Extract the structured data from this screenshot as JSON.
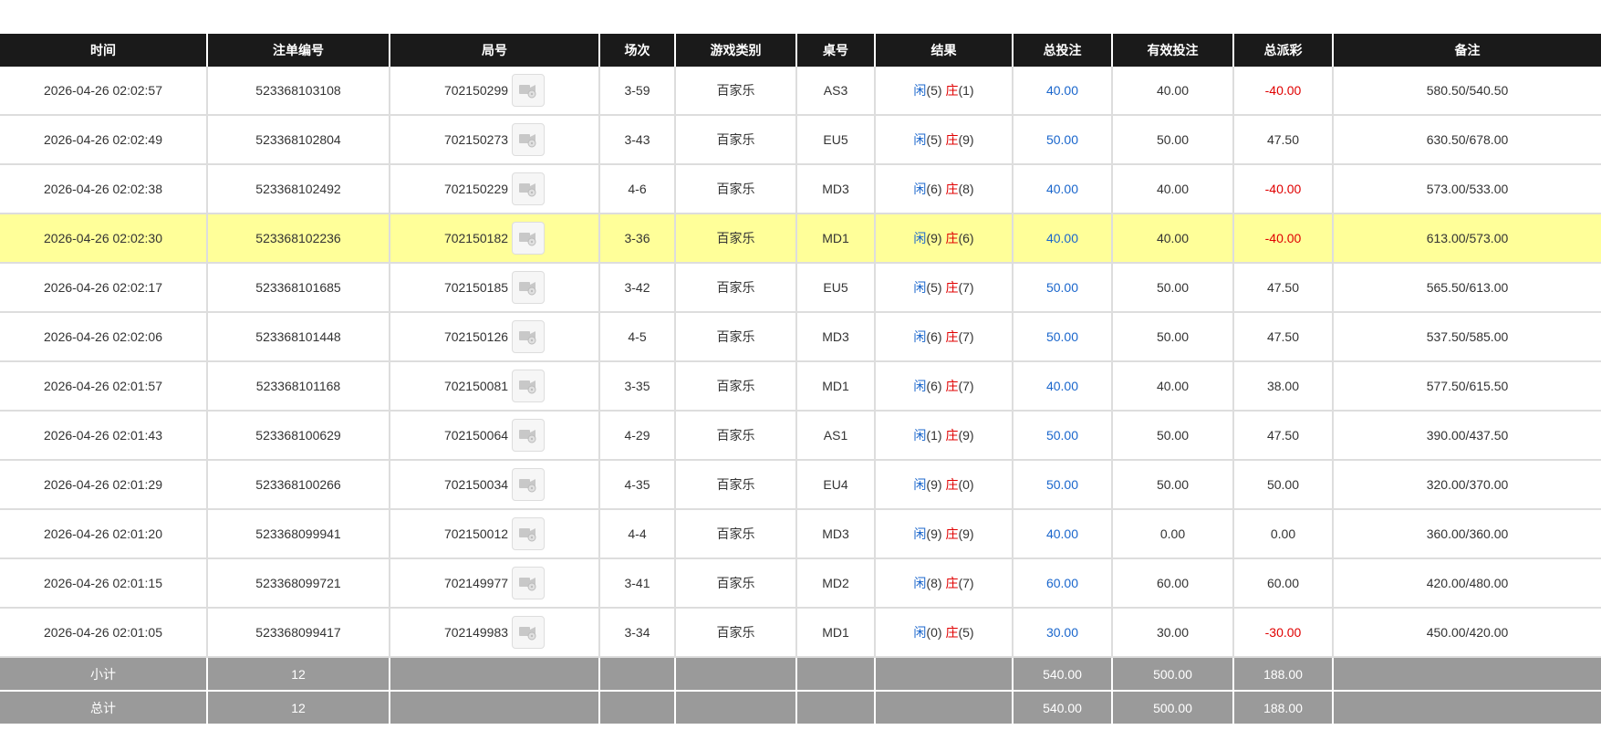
{
  "columns": [
    "时间",
    "注单编号",
    "局号",
    "场次",
    "游戏类别",
    "桌号",
    "结果",
    "总投注",
    "有效投注",
    "总派彩",
    "备注"
  ],
  "colors": {
    "header_bg": "#1a1a1a",
    "highlight_row": "#ffff99",
    "bet_blue": "#1a66cc",
    "loss_red": "#e00000",
    "summary_bg": "#9a9a9a"
  },
  "icons": {
    "replay": "video-replay-icon"
  },
  "rows": [
    {
      "time": "2026-04-26 02:02:57",
      "bet_id": "523368103108",
      "round": "702150299",
      "session": "3-59",
      "game": "百家乐",
      "table": "AS3",
      "xian_label": "闲",
      "xian_val": "(5)",
      "zhuang_label": "庄",
      "zhuang_val": "(1)",
      "total_bet": "40.00",
      "valid_bet": "40.00",
      "payout": "-40.00",
      "payout_neg": true,
      "remark": "580.50/540.50",
      "highlight": false
    },
    {
      "time": "2026-04-26 02:02:49",
      "bet_id": "523368102804",
      "round": "702150273",
      "session": "3-43",
      "game": "百家乐",
      "table": "EU5",
      "xian_label": "闲",
      "xian_val": "(5)",
      "zhuang_label": "庄",
      "zhuang_val": "(9)",
      "total_bet": "50.00",
      "valid_bet": "50.00",
      "payout": "47.50",
      "payout_neg": false,
      "remark": "630.50/678.00",
      "highlight": false
    },
    {
      "time": "2026-04-26 02:02:38",
      "bet_id": "523368102492",
      "round": "702150229",
      "session": "4-6",
      "game": "百家乐",
      "table": "MD3",
      "xian_label": "闲",
      "xian_val": "(6)",
      "zhuang_label": "庄",
      "zhuang_val": "(8)",
      "total_bet": "40.00",
      "valid_bet": "40.00",
      "payout": "-40.00",
      "payout_neg": true,
      "remark": "573.00/533.00",
      "highlight": false
    },
    {
      "time": "2026-04-26 02:02:30",
      "bet_id": "523368102236",
      "round": "702150182",
      "session": "3-36",
      "game": "百家乐",
      "table": "MD1",
      "xian_label": "闲",
      "xian_val": "(9)",
      "zhuang_label": "庄",
      "zhuang_val": "(6)",
      "total_bet": "40.00",
      "valid_bet": "40.00",
      "payout": "-40.00",
      "payout_neg": true,
      "remark": "613.00/573.00",
      "highlight": true
    },
    {
      "time": "2026-04-26 02:02:17",
      "bet_id": "523368101685",
      "round": "702150185",
      "session": "3-42",
      "game": "百家乐",
      "table": "EU5",
      "xian_label": "闲",
      "xian_val": "(5)",
      "zhuang_label": "庄",
      "zhuang_val": "(7)",
      "total_bet": "50.00",
      "valid_bet": "50.00",
      "payout": "47.50",
      "payout_neg": false,
      "remark": "565.50/613.00",
      "highlight": false
    },
    {
      "time": "2026-04-26 02:02:06",
      "bet_id": "523368101448",
      "round": "702150126",
      "session": "4-5",
      "game": "百家乐",
      "table": "MD3",
      "xian_label": "闲",
      "xian_val": "(6)",
      "zhuang_label": "庄",
      "zhuang_val": "(7)",
      "total_bet": "50.00",
      "valid_bet": "50.00",
      "payout": "47.50",
      "payout_neg": false,
      "remark": "537.50/585.00",
      "highlight": false
    },
    {
      "time": "2026-04-26 02:01:57",
      "bet_id": "523368101168",
      "round": "702150081",
      "session": "3-35",
      "game": "百家乐",
      "table": "MD1",
      "xian_label": "闲",
      "xian_val": "(6)",
      "zhuang_label": "庄",
      "zhuang_val": "(7)",
      "total_bet": "40.00",
      "valid_bet": "40.00",
      "payout": "38.00",
      "payout_neg": false,
      "remark": "577.50/615.50",
      "highlight": false
    },
    {
      "time": "2026-04-26 02:01:43",
      "bet_id": "523368100629",
      "round": "702150064",
      "session": "4-29",
      "game": "百家乐",
      "table": "AS1",
      "xian_label": "闲",
      "xian_val": "(1)",
      "zhuang_label": "庄",
      "zhuang_val": "(9)",
      "total_bet": "50.00",
      "valid_bet": "50.00",
      "payout": "47.50",
      "payout_neg": false,
      "remark": "390.00/437.50",
      "highlight": false
    },
    {
      "time": "2026-04-26 02:01:29",
      "bet_id": "523368100266",
      "round": "702150034",
      "session": "4-35",
      "game": "百家乐",
      "table": "EU4",
      "xian_label": "闲",
      "xian_val": "(9)",
      "zhuang_label": "庄",
      "zhuang_val": "(0)",
      "total_bet": "50.00",
      "valid_bet": "50.00",
      "payout": "50.00",
      "payout_neg": false,
      "remark": "320.00/370.00",
      "highlight": false
    },
    {
      "time": "2026-04-26 02:01:20",
      "bet_id": "523368099941",
      "round": "702150012",
      "session": "4-4",
      "game": "百家乐",
      "table": "MD3",
      "xian_label": "闲",
      "xian_val": "(9)",
      "zhuang_label": "庄",
      "zhuang_val": "(9)",
      "total_bet": "40.00",
      "valid_bet": "0.00",
      "payout": "0.00",
      "payout_neg": false,
      "remark": "360.00/360.00",
      "highlight": false
    },
    {
      "time": "2026-04-26 02:01:15",
      "bet_id": "523368099721",
      "round": "702149977",
      "session": "3-41",
      "game": "百家乐",
      "table": "MD2",
      "xian_label": "闲",
      "xian_val": "(8)",
      "zhuang_label": "庄",
      "zhuang_val": "(7)",
      "total_bet": "60.00",
      "valid_bet": "60.00",
      "payout": "60.00",
      "payout_neg": false,
      "remark": "420.00/480.00",
      "highlight": false
    },
    {
      "time": "2026-04-26 02:01:05",
      "bet_id": "523368099417",
      "round": "702149983",
      "session": "3-34",
      "game": "百家乐",
      "table": "MD1",
      "xian_label": "闲",
      "xian_val": "(0)",
      "zhuang_label": "庄",
      "zhuang_val": "(5)",
      "total_bet": "30.00",
      "valid_bet": "30.00",
      "payout": "-30.00",
      "payout_neg": true,
      "remark": "450.00/420.00",
      "highlight": false
    }
  ],
  "subtotal": {
    "label": "小计",
    "count": "12",
    "total_bet": "540.00",
    "valid_bet": "500.00",
    "payout": "188.00"
  },
  "grand_total": {
    "label": "总计",
    "count": "12",
    "total_bet": "540.00",
    "valid_bet": "500.00",
    "payout": "188.00"
  }
}
